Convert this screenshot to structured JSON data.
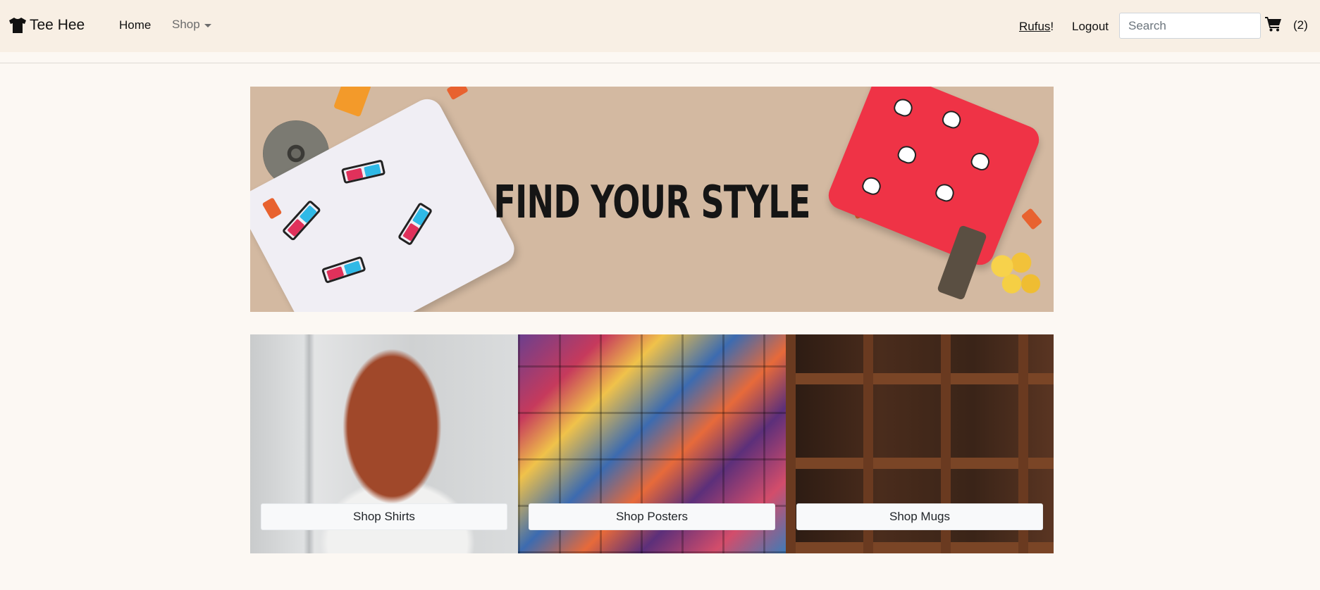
{
  "brand": {
    "name": "Tee Hee",
    "icon": "tshirt-icon"
  },
  "nav": {
    "home": "Home",
    "shop": "Shop",
    "user": "Rufus",
    "user_suffix": "!",
    "logout": "Logout",
    "search_placeholder": "Search",
    "cart_icon": "cart-icon",
    "cart_count": "(2)"
  },
  "hero": {
    "title": "FIND YOUR STYLE"
  },
  "tiles": [
    {
      "label": "Shop Shirts"
    },
    {
      "label": "Shop Posters"
    },
    {
      "label": "Shop Mugs"
    }
  ],
  "colors": {
    "navbar_bg": "#f8efe4",
    "page_bg": "#fcf8f3",
    "hero_bg": "#d3b9a1",
    "button_bg": "#f8f9fa"
  }
}
